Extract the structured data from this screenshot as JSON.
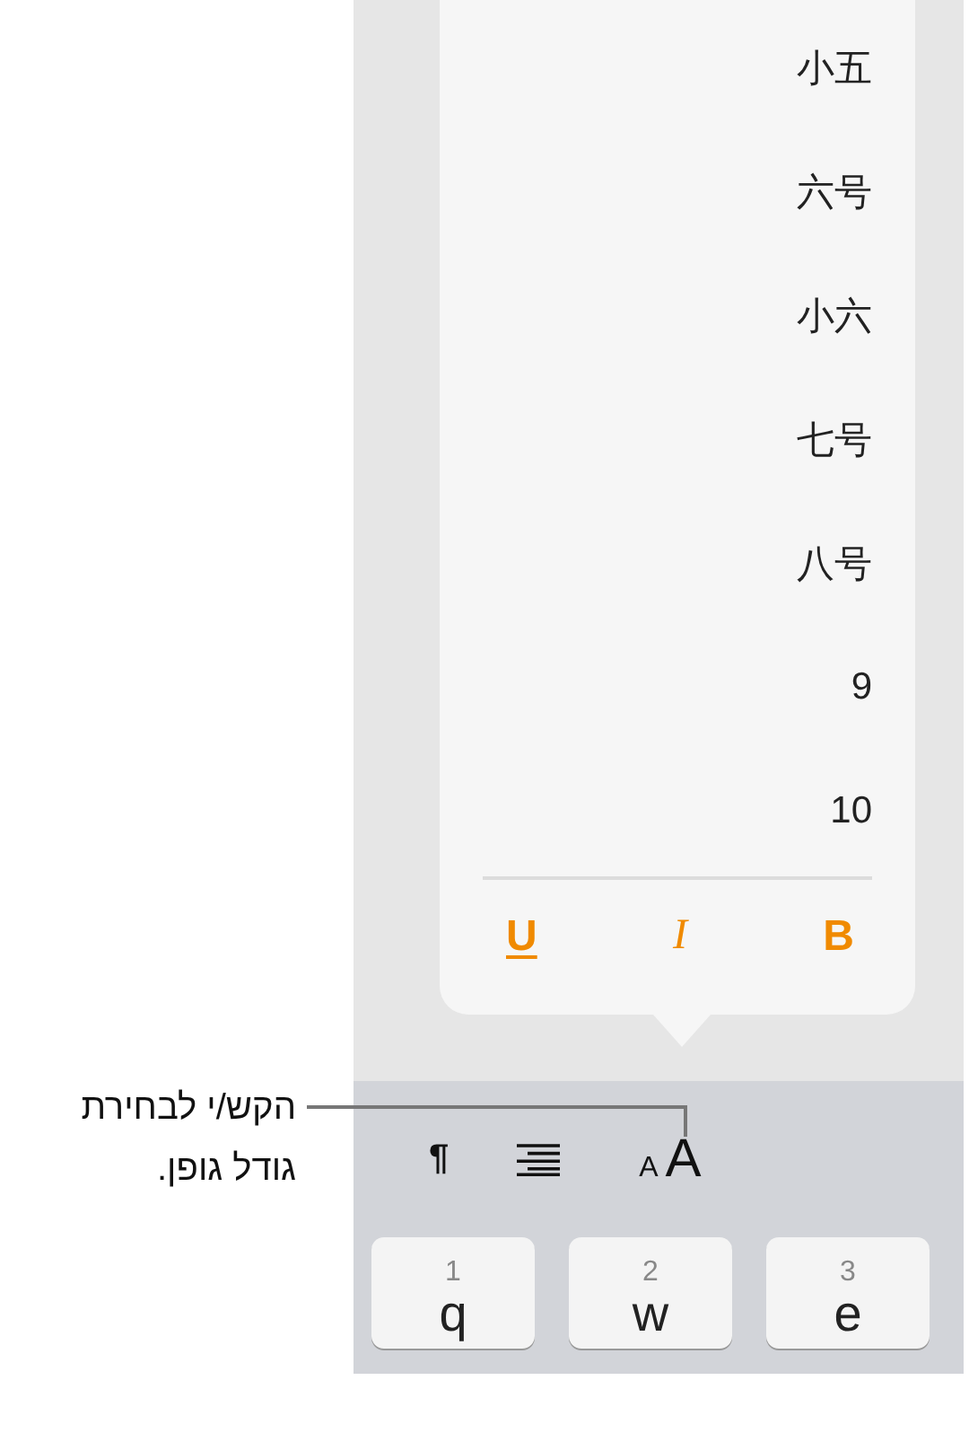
{
  "callout": {
    "text": "הקש/י לבחירת גודל גופן."
  },
  "font_sizes": [
    "小五",
    "六号",
    "小六",
    "七号",
    "八号",
    "9",
    "10"
  ],
  "style_buttons": [
    {
      "kind": "bold",
      "label": "B"
    },
    {
      "kind": "italic",
      "label": "I"
    },
    {
      "kind": "underline",
      "label": "U"
    }
  ],
  "toolbar": [
    {
      "kind": "font-size",
      "small": "A",
      "large": "A"
    },
    {
      "kind": "align"
    },
    {
      "kind": "paragraph",
      "label": "¶"
    }
  ],
  "keys": [
    {
      "digit": "3",
      "letter": "e"
    },
    {
      "digit": "2",
      "letter": "w"
    },
    {
      "digit": "1",
      "letter": "q"
    }
  ]
}
